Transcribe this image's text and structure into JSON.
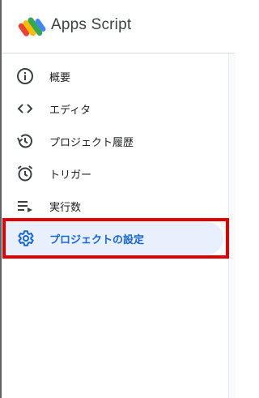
{
  "app": {
    "title": "Apps Script"
  },
  "nav": {
    "items": [
      {
        "label": "概要",
        "icon": "info-icon"
      },
      {
        "label": "エディタ",
        "icon": "code-icon"
      },
      {
        "label": "プロジェクト履歴",
        "icon": "history-icon"
      },
      {
        "label": "トリガー",
        "icon": "alarm-icon"
      },
      {
        "label": "実行数",
        "icon": "executions-icon"
      },
      {
        "label": "プロジェクトの設定",
        "icon": "gear-icon",
        "active": true
      }
    ]
  },
  "colors": {
    "active_bg": "#e8f0fe",
    "active_text": "#1967d2",
    "highlight": "#e00000",
    "icon": "#3c4043"
  }
}
